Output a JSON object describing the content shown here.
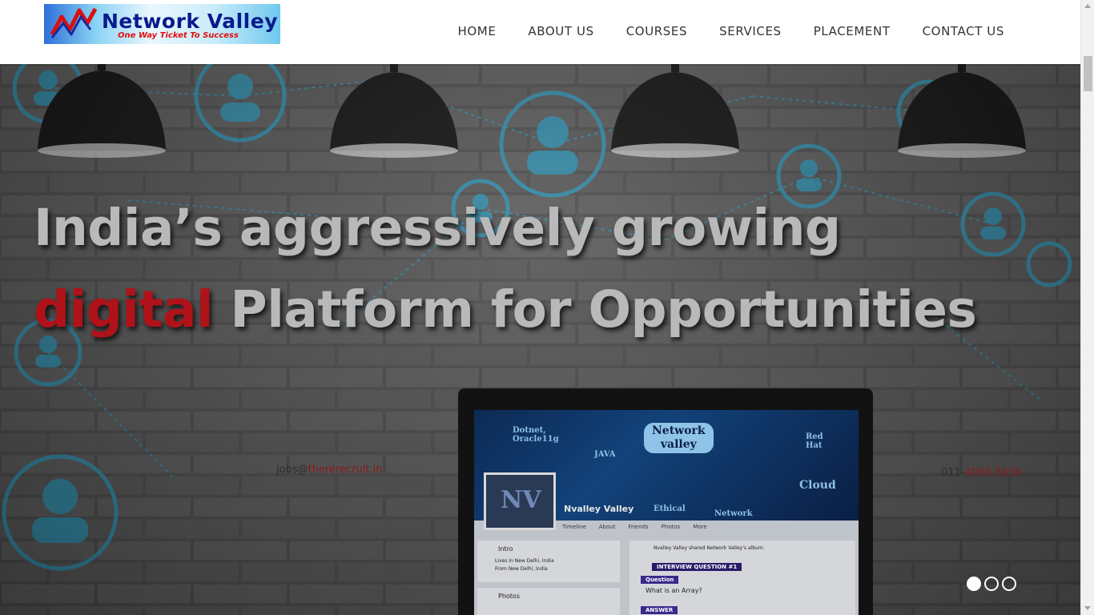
{
  "brand": {
    "name": "Network Valley",
    "tagline": "One Way Ticket To Success"
  },
  "nav": {
    "items": [
      "HOME",
      "ABOUT US",
      "COURSES",
      "SERVICES",
      "PLACEMENT",
      "CONTACT US"
    ]
  },
  "hero": {
    "line1": "India’s aggressively growing",
    "line2_accent": "digital",
    "line2_rest": " Platform for Opportunities",
    "email_prefix": "jobs@",
    "email_domain": "thererecruit.in",
    "phone_prefix": "011-",
    "phone_number": "4000-5859",
    "accent_color": "#b0121a"
  },
  "laptop": {
    "cover_title_1": "Network",
    "cover_title_2": "valley",
    "tag_dotnet": "Dotnet, Oracle11g",
    "tag_java": "JAVA",
    "tag_redhat": "Red Hat",
    "tag_cloud": "Cloud",
    "tag_ethical": "Ethical",
    "tag_network": "Network",
    "profile_initials": "NV",
    "profile_name": "Nvalley Valley",
    "tabs": [
      "Timeline",
      "About",
      "Friends",
      "Photos",
      "More"
    ],
    "intro_label": "Intro",
    "intro_line1": "Lives in New Delhi, India",
    "intro_line2": "From New Delhi, India",
    "photos_label": "Photos",
    "post_author": "Nvalley Valley shared Network Valley's album.",
    "interview_banner": "INTERVIEW QUESTION #1",
    "question_label": "Question",
    "question_text": "What is an Array?",
    "answer_label": "ANSWER"
  },
  "carousel": {
    "slides": 3,
    "active_index": 0
  }
}
